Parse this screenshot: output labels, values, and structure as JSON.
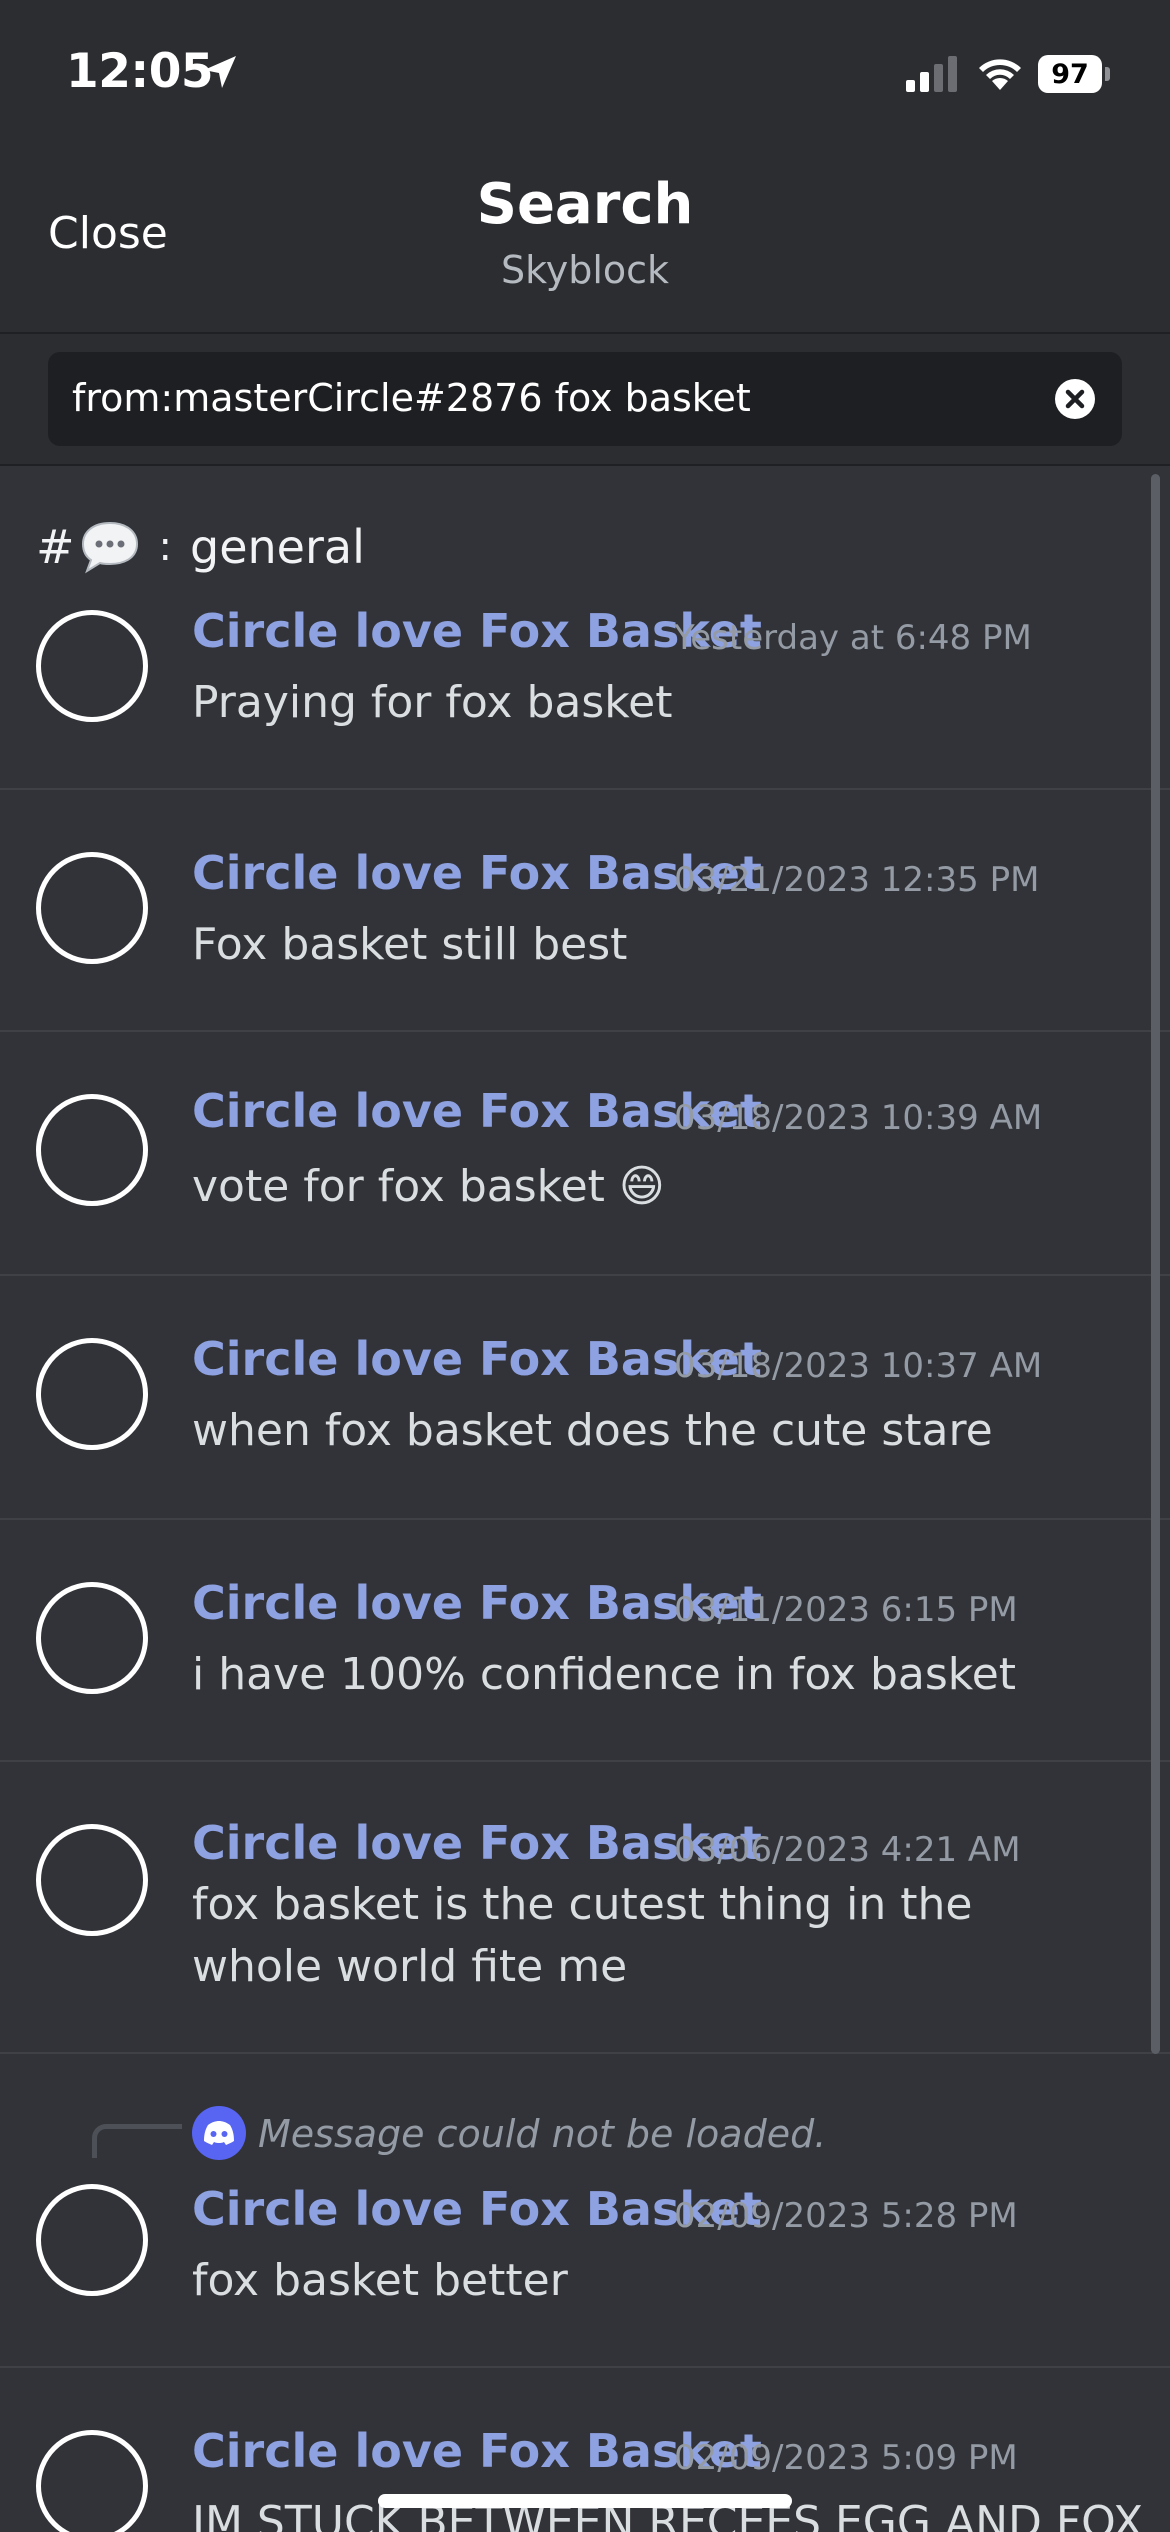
{
  "status_bar": {
    "time": "12:05",
    "battery": "97"
  },
  "header": {
    "close_label": "Close",
    "title": "Search",
    "subtitle": "Skyblock"
  },
  "search": {
    "query": "from:masterCircle#2876 fox basket"
  },
  "channel": {
    "hash": "#",
    "separator": ":",
    "name": "general"
  },
  "results": [
    {
      "author": "Circle love Fox Basket",
      "timestamp": "Yesterday at 6:48 PM",
      "message": "Praying for fox basket"
    },
    {
      "author": "Circle love Fox Basket",
      "timestamp": "03/21/2023 12:35 PM",
      "message": "Fox basket still best"
    },
    {
      "author": "Circle love Fox Basket",
      "timestamp": "03/18/2023 10:39 AM",
      "message": "vote for fox basket 😄"
    },
    {
      "author": "Circle love Fox Basket",
      "timestamp": "03/18/2023 10:37 AM",
      "message": "when fox basket does the cute stare"
    },
    {
      "author": "Circle love Fox Basket",
      "timestamp": "03/11/2023 6:15 PM",
      "message": "i have 100% confidence in fox basket"
    },
    {
      "author": "Circle love Fox Basket",
      "timestamp": "03/06/2023 4:21 AM",
      "message": "fox basket is the cutest thing in the whole world fite me"
    },
    {
      "author": "Circle love Fox Basket",
      "timestamp": "02/09/2023 5:28 PM",
      "message": "fox basket better",
      "reply_text": "Message could not be loaded."
    },
    {
      "author": "Circle love Fox Basket",
      "timestamp": "02/09/2023 5:09 PM",
      "message": "IM STUCK BETWEEN RECEES EGG AND FOX"
    }
  ],
  "icons": {
    "location": "location-arrow-icon",
    "signal": "cellular-signal-icon",
    "wifi": "wifi-icon",
    "clear": "clear-search-icon",
    "bubble": "speech-bubble-icon",
    "discord": "discord-logo-icon"
  },
  "colors": {
    "background": "#313338",
    "header": "#2b2d31",
    "author": "#8ea1e1",
    "blurple": "#5865f2"
  }
}
